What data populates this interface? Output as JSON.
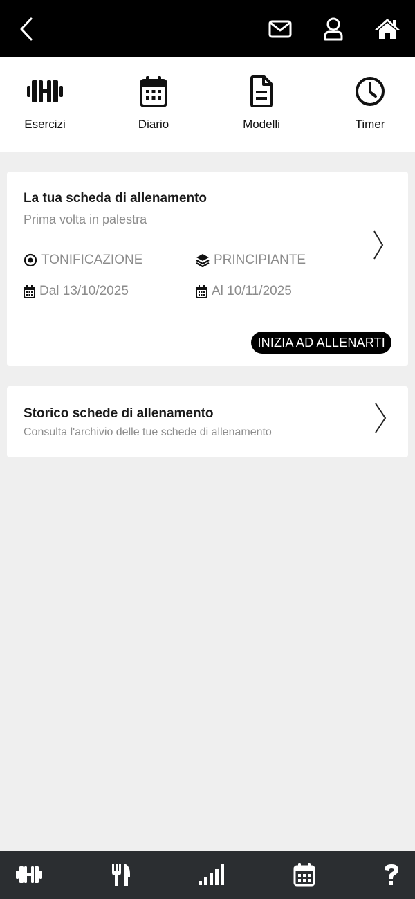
{
  "topbar": {
    "icons": [
      "back-icon",
      "mail-icon",
      "user-icon",
      "home-icon"
    ]
  },
  "quicknav": {
    "items": [
      {
        "label": "Esercizi",
        "icon": "dumbbell-icon"
      },
      {
        "label": "Diario",
        "icon": "calendar-icon"
      },
      {
        "label": "Modelli",
        "icon": "document-icon"
      },
      {
        "label": "Timer",
        "icon": "clock-icon"
      }
    ]
  },
  "current_plan": {
    "title": "La tua scheda di allenamento",
    "subtitle": "Prima volta in palestra",
    "goal": "TONIFICAZIONE",
    "level": "PRINCIPIANTE",
    "start": "Dal 13/10/2025",
    "end": "Al 10/11/2025",
    "cta_label": "INIZIA AD ALLENARTI"
  },
  "history": {
    "title": "Storico schede di allenamento",
    "subtitle": "Consulta l'archivio delle tue schede di allenamento"
  },
  "bottombar": {
    "icons": [
      "dumbbell-icon",
      "cutlery-icon",
      "signal-bars-icon",
      "calendar-icon",
      "help-icon"
    ]
  },
  "colors": {
    "topbar": "#000000",
    "bottombar": "#2b2e31",
    "background": "#efefef",
    "muted_text": "#8c8c8c"
  }
}
